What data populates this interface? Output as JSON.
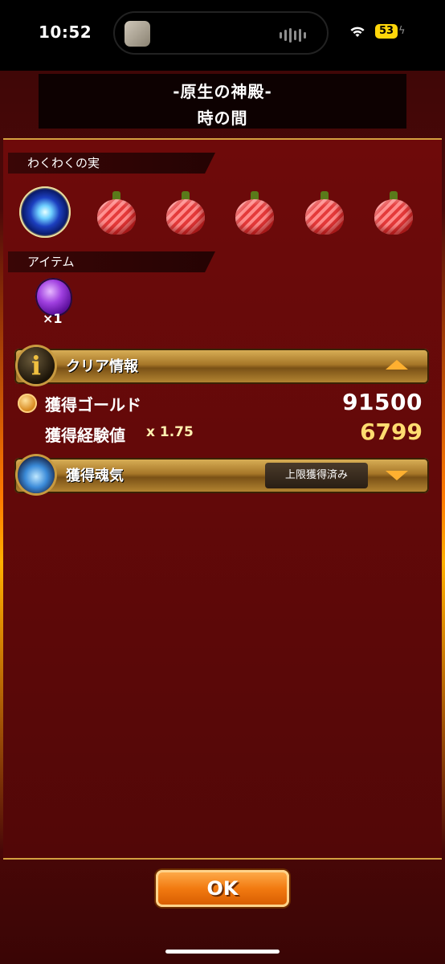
{
  "status_bar": {
    "time": "10:52",
    "battery": "53"
  },
  "header": {
    "title": "-原生の神殿-",
    "subtitle": "時の間"
  },
  "rewards": {
    "fruits_label": "わくわくの実",
    "fruits": [
      "orb",
      "fruit",
      "fruit",
      "fruit",
      "fruit",
      "fruit"
    ],
    "items_label": "アイテム",
    "items": [
      {
        "icon": "purple-crystal",
        "quantity": "×1"
      }
    ]
  },
  "clear_info": {
    "label": "クリア情報",
    "gold_label": "獲得ゴールド",
    "gold_value": "91500",
    "exp_label": "獲得経験値",
    "exp_multiplier": "x 1.75",
    "exp_value": "6799"
  },
  "soul": {
    "label": "獲得魂気",
    "badge": "上限獲得済み"
  },
  "ok_button": "OK",
  "colors": {
    "panel": "#620909",
    "gold_bar": "#a67628",
    "ok_button": "#f27a10",
    "exp_value": "#ffdc70"
  }
}
